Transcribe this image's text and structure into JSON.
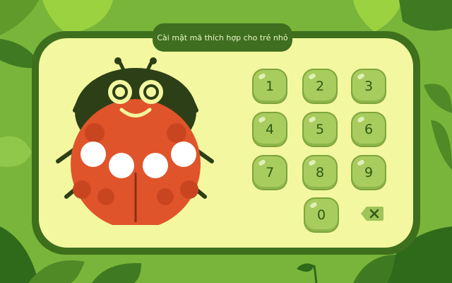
{
  "title": "Cài mật mã thích hợp cho trẻ nhỏ",
  "keypad": {
    "keys": [
      "1",
      "2",
      "3",
      "4",
      "5",
      "6",
      "7",
      "8",
      "9",
      "0"
    ]
  },
  "delete_icon": "backspace-x-icon",
  "pin_slots": {
    "entered": 0,
    "total": 4
  },
  "colors": {
    "background": "#79b53a",
    "panel_border": "#3e6f1d",
    "panel_fill": "#f3f7a0",
    "key_fill": "#a8cc5e",
    "ladybug_red": "#e0542b"
  }
}
